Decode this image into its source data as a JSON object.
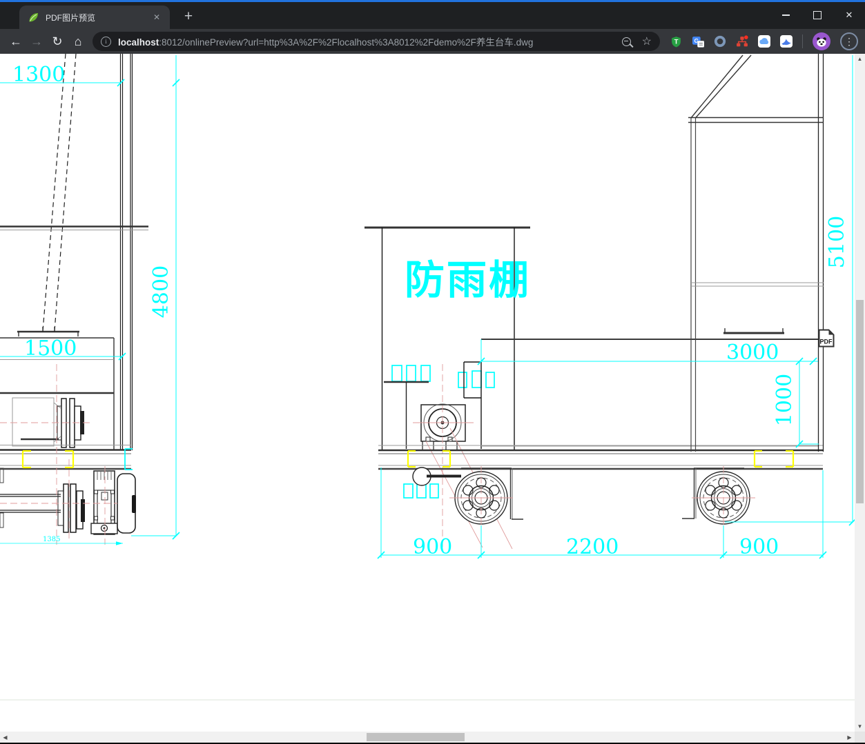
{
  "chrome": {
    "accent_color": "#2173de",
    "tab_title": "PDF图片预览",
    "url_host": "localhost",
    "url_rest": ":8012/onlinePreview?url=http%3A%2F%2Flocalhost%3A8012%2Fdemo%2F养生台车.dwg",
    "icons": {
      "back": "←",
      "forward": "→",
      "reload": "↻",
      "home": "⌂",
      "info": "i",
      "star": "☆",
      "new_tab": "+",
      "tab_close": "✕",
      "window_close": "✕",
      "menu": "⋮",
      "scroll_up": "▲",
      "scroll_down": "▼",
      "scroll_left": "◀",
      "scroll_right": "▶"
    }
  },
  "drawing": {
    "shelter_label": "防雨棚",
    "pdf_button_label": "PDF",
    "dimensions": {
      "top_left_width": "1300",
      "left_height": "4800",
      "left_inner_width": "1500",
      "left_axle_span": "1385",
      "bottom_left": "900",
      "bottom_center": "2200",
      "bottom_right": "900",
      "platform_width": "3000",
      "platform_height": "1000",
      "total_height": "5100"
    },
    "colors": {
      "dimension_cyan": "#00ffff",
      "highlight_yellow": "#ffff00",
      "centerline_pink": "#e09b9b"
    }
  }
}
